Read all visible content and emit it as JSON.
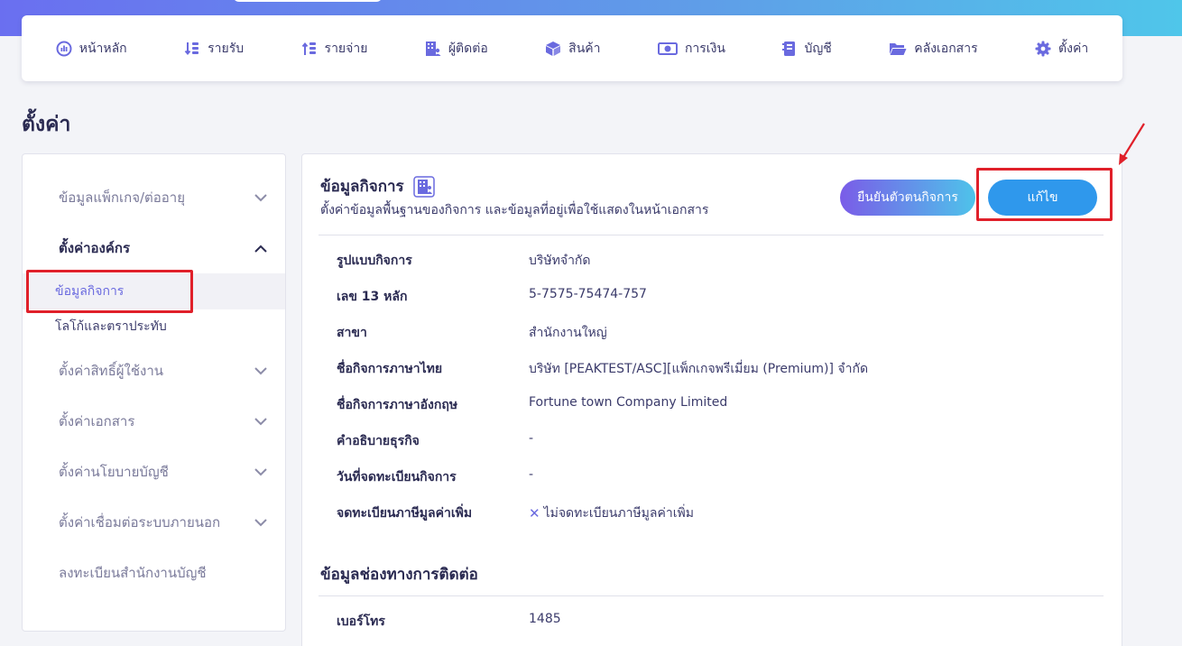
{
  "nav": [
    {
      "label": "หน้าหลัก",
      "icon": "dashboard-icon"
    },
    {
      "label": "รายรับ",
      "icon": "income-icon"
    },
    {
      "label": "รายจ่าย",
      "icon": "expense-icon"
    },
    {
      "label": "ผู้ติดต่อ",
      "icon": "contacts-icon"
    },
    {
      "label": "สินค้า",
      "icon": "box-icon"
    },
    {
      "label": "การเงิน",
      "icon": "money-icon"
    },
    {
      "label": "บัญชี",
      "icon": "ledger-icon"
    },
    {
      "label": "คลังเอกสาร",
      "icon": "folder-icon"
    },
    {
      "label": "ตั้งค่า",
      "icon": "gear-icon"
    }
  ],
  "page_title": "ตั้งค่า",
  "sidebar": {
    "groups": [
      {
        "label": "ข้อมูลแพ็กเกจ/ต่ออายุ"
      },
      {
        "label": "ตั้งค่าองค์กร"
      },
      {
        "label": "ตั้งค่าสิทธิ์ผู้ใช้งาน"
      },
      {
        "label": "ตั้งค่าเอกสาร"
      },
      {
        "label": "ตั้งค่านโยบายบัญชี"
      },
      {
        "label": "ตั้งค่าเชื่อมต่อระบบภายนอก"
      },
      {
        "label": "ลงทะเบียนสำนักงานบัญชี"
      }
    ],
    "subitems": [
      {
        "label": "ข้อมูลกิจการ"
      },
      {
        "label": "โลโก้และตราประทับ"
      }
    ]
  },
  "card": {
    "title": "ข้อมูลกิจการ",
    "subtitle": "ตั้งค่าข้อมูลพื้นฐานของกิจการ และข้อมูลที่อยู่เพื่อใช้แสดงในหน้าเอกสาร",
    "verify_button": "ยืนยันตัวตนกิจการ",
    "edit_button": "แก้ไข",
    "rows": [
      {
        "label": "รูปแบบกิจการ",
        "value": "บริษัทจำกัด"
      },
      {
        "label": "เลข 13 หลัก",
        "value": "5-7575-75474-757"
      },
      {
        "label": "สาขา",
        "value": "สำนักงานใหญ่"
      },
      {
        "label": "ชื่อกิจการภาษาไทย",
        "value": "บริษัท [PEAKTEST/ASC][แพ็กเกจพรีเมี่ยม (Premium)] จำกัด"
      },
      {
        "label": "ชื่อกิจการภาษาอังกฤษ",
        "value": "Fortune town Company Limited"
      },
      {
        "label": "คำอธิบายธุรกิจ",
        "value": "-"
      },
      {
        "label": "วันที่จดทะเบียนกิจการ",
        "value": "-"
      },
      {
        "label": "จดทะเบียนภาษีมูลค่าเพิ่ม",
        "value": "ไม่จดทะเบียนภาษีมูลค่าเพิ่ม"
      }
    ],
    "contact_section_title": "ข้อมูลช่องทางการติดต่อ",
    "contact_rows": [
      {
        "label": "เบอร์โทร",
        "value": "1485"
      }
    ]
  },
  "colors": {
    "accent": "#6a6adf",
    "edit_button": "#2f98ec",
    "highlight": "#e0202a"
  }
}
